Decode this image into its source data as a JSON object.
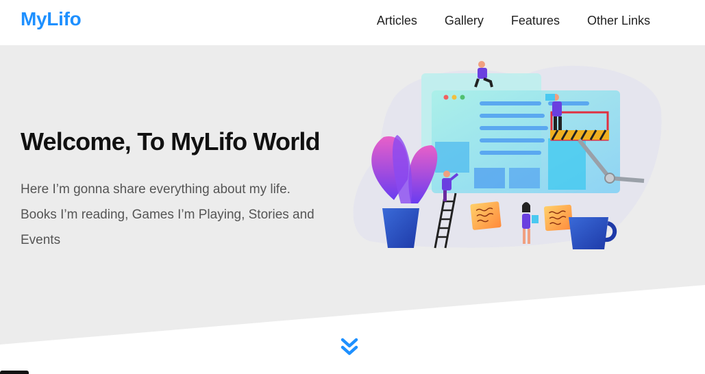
{
  "header": {
    "logo": "MyLifo",
    "nav": [
      {
        "label": "Articles"
      },
      {
        "label": "Gallery"
      },
      {
        "label": "Features"
      },
      {
        "label": "Other Links"
      }
    ]
  },
  "hero": {
    "title": "Welcome, To MyLifo World",
    "lines": [
      "Here I’m gonna share everything about my life.",
      "Books I’m reading, Games I’m Playing, Stories and",
      "Events"
    ]
  },
  "icons": {
    "scroll": "double-chevron-down-icon",
    "illustration": "web-design-team-illustration"
  },
  "colors": {
    "brand": "#1e90ff",
    "hero_bg": "#ececec",
    "text": "#555555"
  }
}
